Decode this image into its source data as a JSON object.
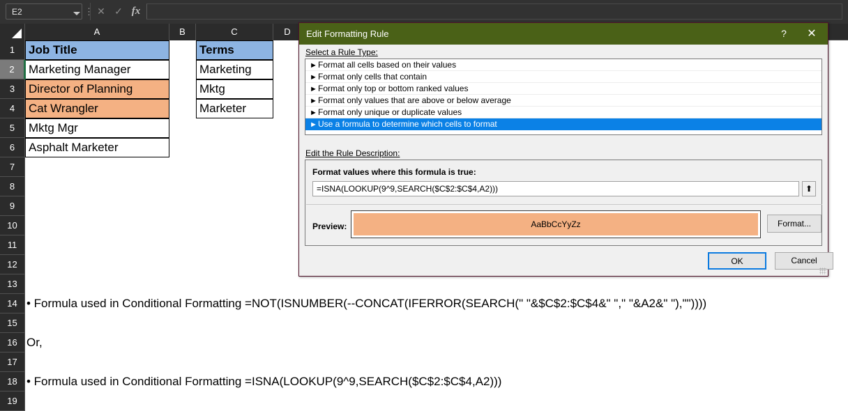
{
  "formula_bar": {
    "name_box_value": "E2",
    "formula_value": "",
    "cancel_icon": "close-icon",
    "enter_icon": "check-icon",
    "fx_label": "fx"
  },
  "grid": {
    "columns": [
      "A",
      "B",
      "C",
      "D"
    ],
    "rows": [
      "1",
      "2",
      "3",
      "4",
      "5",
      "6",
      "7",
      "8",
      "9",
      "10",
      "11",
      "12",
      "13",
      "14",
      "15",
      "16",
      "17",
      "18",
      "19"
    ],
    "selected_row": "2",
    "colors": {
      "header_fill": "#8db4e2",
      "highlight_fill": "#f4b183",
      "plain_fill": "#ffffff"
    },
    "column_a": [
      {
        "row": 1,
        "text": "Job Title",
        "fill": "header",
        "bold": true
      },
      {
        "row": 2,
        "text": "Marketing Manager",
        "fill": "plain",
        "bold": false
      },
      {
        "row": 3,
        "text": "Director of Planning",
        "fill": "highlight",
        "bold": false
      },
      {
        "row": 4,
        "text": "Cat Wrangler",
        "fill": "highlight",
        "bold": false
      },
      {
        "row": 5,
        "text": "Mktg Mgr",
        "fill": "plain",
        "bold": false
      },
      {
        "row": 6,
        "text": "Asphalt Marketer",
        "fill": "plain",
        "bold": false
      }
    ],
    "column_c": [
      {
        "row": 1,
        "text": "Terms",
        "fill": "header",
        "bold": true
      },
      {
        "row": 2,
        "text": "Marketing",
        "fill": "plain",
        "bold": false
      },
      {
        "row": 3,
        "text": "Mktg",
        "fill": "plain",
        "bold": false
      },
      {
        "row": 4,
        "text": "Marketer",
        "fill": "plain",
        "bold": false
      }
    ],
    "notes": [
      {
        "row": 14,
        "text": "• Formula used in Conditional Formatting =NOT(ISNUMBER(--CONCAT(IFERROR(SEARCH(\" \"&$C$2:$C$4&\" \",\" \"&A2&\" \"),\"\"))))"
      },
      {
        "row": 16,
        "text": "Or,"
      },
      {
        "row": 18,
        "text": "• Formula used in Conditional Formatting =ISNA(LOOKUP(9^9,SEARCH($C$2:$C$4,A2)))"
      }
    ]
  },
  "dialog": {
    "title": "Edit Formatting Rule",
    "titlebar_color": "#4a6117",
    "help_label": "?",
    "close_label": "✕",
    "select_rule_type_label": "Select a Rule Type:",
    "rule_types": [
      {
        "label": "Format all cells based on their values",
        "selected": false
      },
      {
        "label": "Format only cells that contain",
        "selected": false
      },
      {
        "label": "Format only top or bottom ranked values",
        "selected": false
      },
      {
        "label": "Format only values that are above or below average",
        "selected": false
      },
      {
        "label": "Format only unique or duplicate values",
        "selected": false
      },
      {
        "label": "Use a formula to determine which cells to format",
        "selected": true
      }
    ],
    "selection_color": "#0b81e6",
    "edit_rule_description_label": "Edit the Rule Description:",
    "formula_true_label": "Format values where this formula is true:",
    "formula_value": "=ISNA(LOOKUP(9^9,SEARCH($C$2:$C$4,A2)))",
    "collapse_icon": "collapse-dialog-arrow-icon",
    "preview_label": "Preview:",
    "preview_sample_text": "AaBbCcYyZz",
    "preview_fill": "#f4b183",
    "format_button_label": "Format...",
    "ok_button_label": "OK",
    "cancel_button_label": "Cancel"
  }
}
